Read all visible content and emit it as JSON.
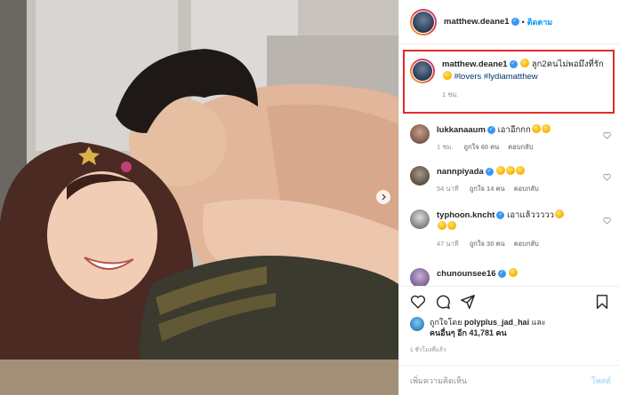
{
  "post": {
    "username": "matthew.deane1",
    "follow_label": "ติดตาม",
    "caption_text": "ลูก2คนไม่พอมึงที่รัก",
    "caption_hashtags": "#lovers #lydiamatthew",
    "caption_age": "1 ชม."
  },
  "comments": [
    {
      "username": "lukkanaaum",
      "text": "เอาอีกกก",
      "age": "1 ชม.",
      "likes": "ถูกใจ 60 คน",
      "reply": "ตอบกลับ"
    },
    {
      "username": "nannpiyada",
      "text": "",
      "age": "54 นาที",
      "likes": "ถูกใจ 14 คน",
      "reply": "ตอบกลับ"
    },
    {
      "username": "typhoon.kncht",
      "text": "เอาแล้ววววว",
      "age": "47 นาที",
      "likes": "ถูกใจ 30 คน",
      "reply": "ตอบกลับ"
    },
    {
      "username": "chunounsee16",
      "text": "",
      "age": "",
      "likes": "",
      "reply": ""
    }
  ],
  "liked_by": {
    "prefix": "ถูกใจโดย",
    "user": "polyplus_jad_hai",
    "and": "และ",
    "others_prefix": "คนอื่นๆ อีก",
    "others_count": "41,781",
    "others_suffix": "คน"
  },
  "post_time": "1 ชั่วโมงที่แล้ว",
  "add_comment": {
    "placeholder": "เพิ่มความคิดเห็น",
    "post_label": "โพสต์"
  },
  "icons": {
    "verified": "verified-badge-icon",
    "heart": "heart-icon",
    "comment": "comment-icon",
    "share": "share-icon",
    "bookmark": "bookmark-icon",
    "carousel": "chevron-right-icon"
  },
  "colors": {
    "accent": "#0095f6",
    "highlight_box": "#e02b2b",
    "hashtag": "#00376b"
  }
}
